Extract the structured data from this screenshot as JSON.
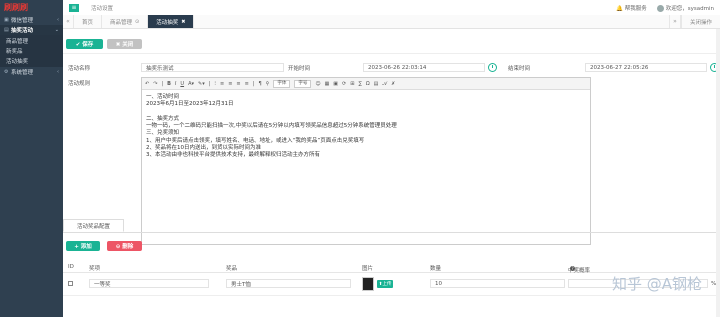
{
  "sidebar": {
    "logo": "刷刷刷",
    "items": [
      {
        "label": "微信管理",
        "active": false
      },
      {
        "label": "抽奖活动",
        "active": true
      }
    ],
    "subitems": [
      "商品管理",
      "新奖品",
      "活动抽奖"
    ],
    "system": "系统管理"
  },
  "topbar": {
    "menu_icon": "≡",
    "breadcrumb": "活动设置",
    "notice": "帮我服务",
    "user": "欢迎您，sysadmin",
    "logout": "退出"
  },
  "tabs": {
    "items": [
      {
        "label": "首页",
        "active": false,
        "closable": false
      },
      {
        "label": "商品管理",
        "active": false,
        "closable": true
      },
      {
        "label": "活动抽奖",
        "active": true,
        "closable": true
      }
    ],
    "close_label": "关闭操作"
  },
  "actions": {
    "save": "✔ 保存",
    "close": "✖ 关闭"
  },
  "form": {
    "name_label": "活动名称",
    "name_value": "抽奖乐测试",
    "start_label": "开始时间",
    "start_value": "2023-06-26 22:03:14",
    "end_label": "结束时间",
    "end_value": "2023-06-27 22:05:26",
    "rules_label": "活动规则"
  },
  "editor": {
    "toolbar": [
      "↶",
      "↷",
      "|",
      "B",
      "I",
      "U",
      "A▾",
      "✎▾",
      "|",
      "⁝",
      "≡",
      "≡",
      "≡",
      "≡",
      "|",
      "¶",
      "⚲"
    ],
    "font_label": "字体",
    "size_label": "字号",
    "toolbar_tail": [
      "☺",
      "▦",
      "▣",
      "⟳",
      "⊞",
      "∑",
      "Ω",
      "▤",
      "𝒜",
      "✗"
    ],
    "lines": [
      "一、活动时间",
      "2023年6月1日至2023年12月31日",
      "",
      "二、抽奖方式",
      "一物一码，一个二维码只能扫描一次,中奖以后请在5分钟以内填写领奖品信息超过5分钟系统管理员处理",
      "三、兑奖须知",
      "1、用户中奖后请点击领奖，填写姓名、电话、地址，或进入“我的奖品”页面点击兑奖填写",
      "2、奖品将在10日内送出，到货以实际时间为准",
      "3、本活动由非也科技平台提供技术支持，最终解释权归活动主办方所有"
    ]
  },
  "section": {
    "tab": "活动奖品配置",
    "add": "+ 添加",
    "delete": "⊖ 删除",
    "headers": {
      "id": "ID",
      "prize": "奖项",
      "product": "奖品",
      "image": "图片",
      "quantity": "数量",
      "probability": "中奖概率",
      "unit": "%"
    },
    "rows": [
      {
        "prize": "一等奖",
        "product": "男士T恤",
        "upload": "⬆上传",
        "quantity": "10"
      }
    ]
  },
  "watermark": "知乎 @A钢枪",
  "colors": {
    "primary": "#1ab394",
    "danger": "#ed5565",
    "sidebar": "#2f4050",
    "tab_active": "#2a3c4e"
  }
}
